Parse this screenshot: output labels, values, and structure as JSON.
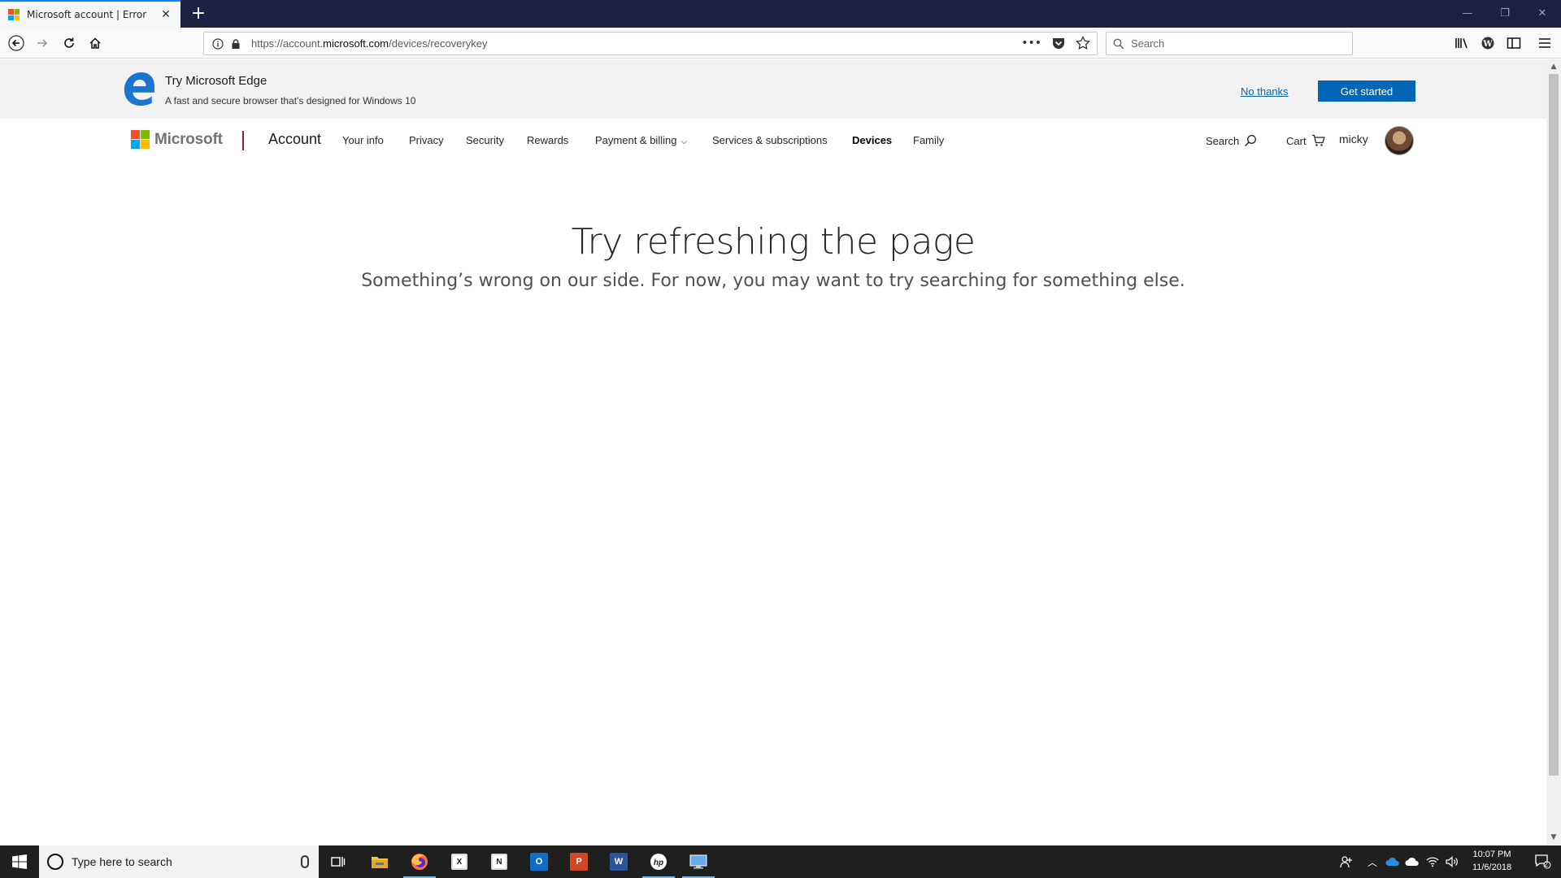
{
  "browser": {
    "tab_title": "Microsoft account | Error",
    "url_prefix": "https://account.",
    "url_domain": "microsoft.com",
    "url_path": "/devices/recoverykey",
    "search_placeholder": "Search"
  },
  "promo": {
    "title": "Try Microsoft Edge",
    "subtitle": "A fast and secure browser that's designed for Windows 10",
    "no_thanks": "No thanks",
    "get_started": "Get started"
  },
  "header": {
    "brand": "Microsoft",
    "section": "Account",
    "nav": [
      {
        "label": "Your info"
      },
      {
        "label": "Privacy"
      },
      {
        "label": "Security"
      },
      {
        "label": "Rewards"
      },
      {
        "label": "Payment & billing"
      },
      {
        "label": "Services & subscriptions"
      },
      {
        "label": "Devices"
      },
      {
        "label": "Family"
      }
    ],
    "active_nav": "Devices",
    "search_label": "Search",
    "cart_label": "Cart",
    "username": "micky"
  },
  "main": {
    "heading": "Try refreshing the page",
    "subheading": "Something’s wrong on our side. For now, you may want to try searching for something else."
  },
  "taskbar": {
    "search_placeholder": "Type here to search",
    "time": "10:07 PM",
    "date": "11/6/2018",
    "notification_count": "2",
    "pinned_apps": [
      "task-view",
      "file-explorer",
      "firefox",
      "excel",
      "onenote",
      "outlook",
      "powerpoint",
      "word",
      "hp",
      "remote-desktop"
    ]
  },
  "colors": {
    "accent": "#0067b8",
    "tab_accent": "#0a84ff",
    "title_bar": "#1c2143",
    "taskbar": "#1f1f1f",
    "ms_red": "#f25022",
    "ms_green": "#7fba00",
    "ms_blue": "#00a4ef",
    "ms_yellow": "#ffb900"
  }
}
